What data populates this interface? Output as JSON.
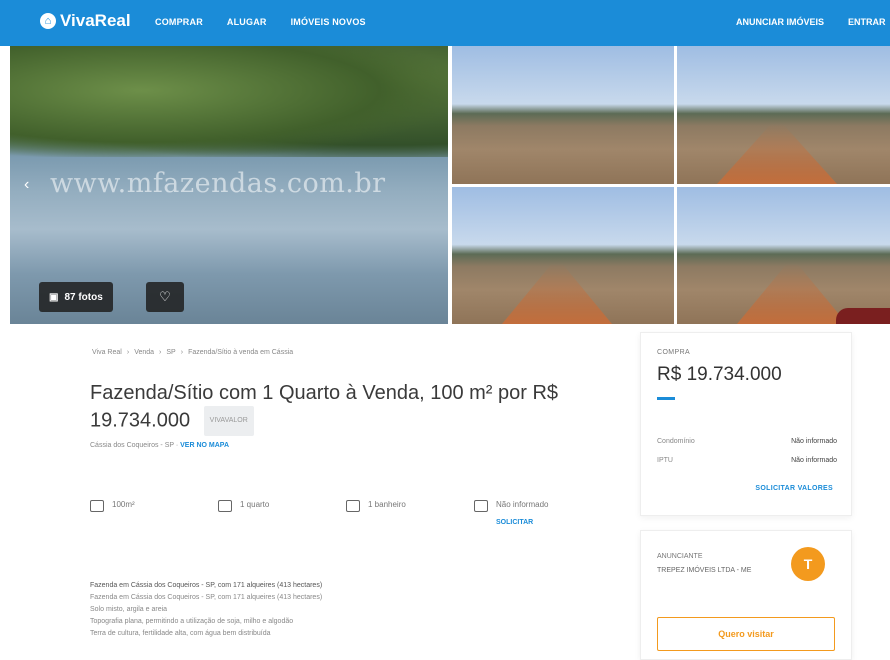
{
  "header": {
    "logo": "VivaReal",
    "nav": [
      "COMPRAR",
      "ALUGAR",
      "IMÓVEIS NOVOS"
    ],
    "right": [
      "ANUNCIAR IMÓVEIS",
      "ENTRAR"
    ]
  },
  "gallery": {
    "watermark": "www.mfazendas.com.br",
    "photos_button": "87 fotos"
  },
  "breadcrumb": [
    "Viva Real",
    "Venda",
    "SP",
    "Fazenda/Sítio à venda em Cássia"
  ],
  "listing": {
    "title": "Fazenda/Sítio com 1 Quarto à Venda, 100 m² por R$ 19.734.000",
    "badge": "VIVAVALOR",
    "code_prefix": "Cássia dos Coqueiros - SP · ",
    "code_link": "VER NO MAPA"
  },
  "features": {
    "area": "100m²",
    "bedrooms": "1 quarto",
    "bathrooms": "1 banheiro",
    "parking": "Não informado",
    "parking_link": "SOLICITAR"
  },
  "description": [
    "Fazenda em Cássia dos Coqueiros - SP, com 171 alqueires (413 hectares)",
    "Fazenda em Cássia dos Coqueiros - SP, com 171 alqueires (413 hectares)",
    "Solo misto, argila e areia",
    "Topografia plana, permitindo a utilização de soja, milho e algodão",
    "Terra de cultura, fertilidade alta, com água bem distribuída"
  ],
  "price_card": {
    "label": "COMPRA",
    "price": "R$ 19.734.000",
    "rows": [
      {
        "label": "Condomínio",
        "value": "Não informado"
      },
      {
        "label": "IPTU",
        "value": "Não informado"
      }
    ],
    "link": "SOLICITAR VALORES"
  },
  "advertiser": {
    "label": "ANUNCIANTE",
    "name": "TREPEZ IMÓVEIS LTDA - ME",
    "logo_text": "T",
    "button": "Quero visitar"
  },
  "colors": {
    "brand": "#1b8cd8",
    "accent": "#f39a1e"
  }
}
